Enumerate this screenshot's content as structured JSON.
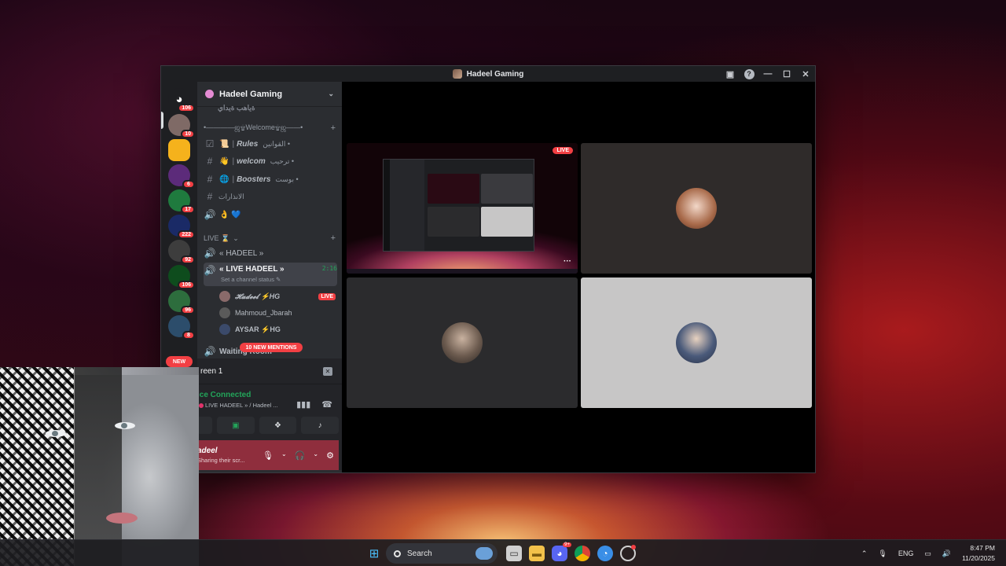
{
  "window": {
    "title": "Hadeel Gaming"
  },
  "rail": {
    "servers": [
      {
        "badge": "106",
        "color": "#5865f2"
      },
      {
        "badge": "10",
        "color": "#7f6a66"
      },
      {
        "badge": "",
        "color": "#f5b21c"
      },
      {
        "badge": "6",
        "color": "#5c2b7a"
      },
      {
        "badge": "17",
        "color": "#1f7a3e"
      },
      {
        "badge": "222",
        "color": "#1a2a66"
      },
      {
        "badge": "92",
        "color": "#3d3d3d"
      },
      {
        "badge": "106",
        "color": "#0e4c1d"
      },
      {
        "badge": "96",
        "color": "#2d6d3d"
      },
      {
        "badge": "8",
        "color": "#2c4d6b"
      }
    ],
    "new_label": "NEW"
  },
  "sidebar": {
    "guild_name": "Hadeel Gaming",
    "cut_text": "ةياهب ةيداي",
    "welcome_category": "•————ஜ۩Welcome۩ஜ——•",
    "channels": [
      {
        "prefix": "☑",
        "emoji": "📜",
        "name": "Rules",
        "arabic": "القوانين •"
      },
      {
        "prefix": "#",
        "emoji": "👋",
        "name": "welcom",
        "arabic": "ترحيب •"
      },
      {
        "prefix": "#",
        "emoji": "🌐",
        "name": "Boosters",
        "arabic": "بوست •"
      },
      {
        "prefix": "#",
        "emoji": "",
        "name": "",
        "arabic": "الانذارات"
      },
      {
        "prefix": "🔊",
        "emoji": "👌 💙",
        "name": "",
        "arabic": ""
      }
    ],
    "live_category": "LIVE ⌛",
    "voice_channel_1": "« HADEEL »",
    "active_channel": {
      "name": "« LIVE HADEEL »",
      "timer": "2:16",
      "status": "Set a channel status ✎"
    },
    "users": [
      {
        "name": "𝓗𝓪𝓭𝓮𝓮𝓵 ⚡HG",
        "live": "LIVE"
      },
      {
        "name": "Mahmoud_Jbarah",
        "live": ""
      },
      {
        "name": "AYSAR ⚡HG",
        "live": ""
      }
    ],
    "next_channel": "Waiting Room",
    "mentions_label": "10 NEW MENTIONS"
  },
  "voice_panel": {
    "screen_label": "reen 1",
    "connected": "ice Connected",
    "channel_path": "LIVE HADEEL » / Hadeel ...",
    "user_name": "adeel",
    "user_status": "Sharing their scr..."
  },
  "stage": {
    "live_label": "LIVE",
    "more_label": "···"
  },
  "taskbar": {
    "search_placeholder": "Search",
    "language": "ENG",
    "time": "8:47 PM",
    "date": "11/20/2025",
    "discord_badge": "9+"
  }
}
